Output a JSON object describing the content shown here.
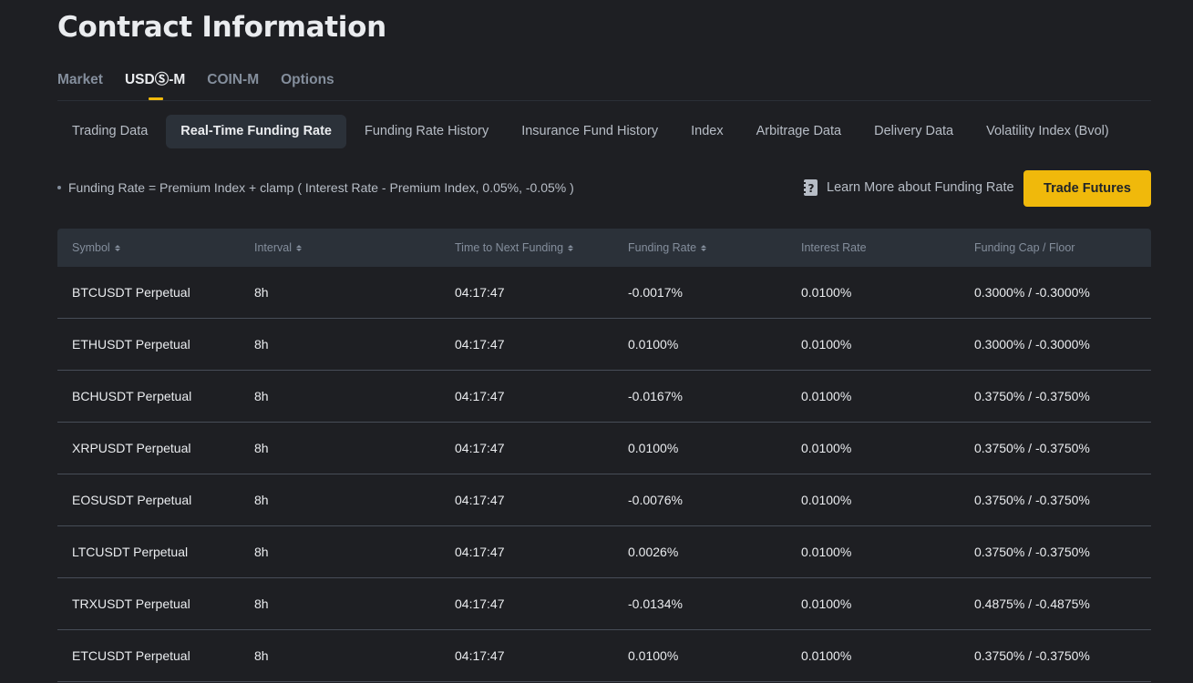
{
  "page": {
    "title": "Contract Information"
  },
  "market_tabs": [
    {
      "label": "Market",
      "active": false
    },
    {
      "label": "USDⓈ-M",
      "active": true
    },
    {
      "label": "COIN-M",
      "active": false
    },
    {
      "label": "Options",
      "active": false
    }
  ],
  "sub_tabs": [
    {
      "label": "Trading Data",
      "active": false
    },
    {
      "label": "Real-Time Funding Rate",
      "active": true
    },
    {
      "label": "Funding Rate History",
      "active": false
    },
    {
      "label": "Insurance Fund History",
      "active": false
    },
    {
      "label": "Index",
      "active": false
    },
    {
      "label": "Arbitrage Data",
      "active": false
    },
    {
      "label": "Delivery Data",
      "active": false
    },
    {
      "label": "Volatility Index (Bvol)",
      "active": false
    }
  ],
  "formula": "Funding Rate = Premium Index + clamp ( Interest Rate - Premium Index, 0.05%, -0.05% )",
  "learn_more": {
    "label": "Learn More about Funding Rate",
    "icon": "help-document-icon"
  },
  "trade_button": {
    "label": "Trade Futures"
  },
  "colors": {
    "accent": "#f0b90b",
    "background": "#1e1f23",
    "header_bg": "#2b3139"
  },
  "table": {
    "headers": [
      "Symbol",
      "Interval",
      "Time to Next Funding",
      "Funding Rate",
      "Interest Rate",
      "Funding Cap / Floor"
    ],
    "rows": [
      [
        "BTCUSDT Perpetual",
        "8h",
        "04:17:47",
        "-0.0017%",
        "0.0100%",
        "0.3000% / -0.3000%"
      ],
      [
        "ETHUSDT Perpetual",
        "8h",
        "04:17:47",
        "0.0100%",
        "0.0100%",
        "0.3000% / -0.3000%"
      ],
      [
        "BCHUSDT Perpetual",
        "8h",
        "04:17:47",
        "-0.0167%",
        "0.0100%",
        "0.3750% / -0.3750%"
      ],
      [
        "XRPUSDT Perpetual",
        "8h",
        "04:17:47",
        "0.0100%",
        "0.0100%",
        "0.3750% / -0.3750%"
      ],
      [
        "EOSUSDT Perpetual",
        "8h",
        "04:17:47",
        "-0.0076%",
        "0.0100%",
        "0.3750% / -0.3750%"
      ],
      [
        "LTCUSDT Perpetual",
        "8h",
        "04:17:47",
        "0.0026%",
        "0.0100%",
        "0.3750% / -0.3750%"
      ],
      [
        "TRXUSDT Perpetual",
        "8h",
        "04:17:47",
        "-0.0134%",
        "0.0100%",
        "0.4875% / -0.4875%"
      ],
      [
        "ETCUSDT Perpetual",
        "8h",
        "04:17:47",
        "0.0100%",
        "0.0100%",
        "0.3750% / -0.3750%"
      ]
    ]
  }
}
